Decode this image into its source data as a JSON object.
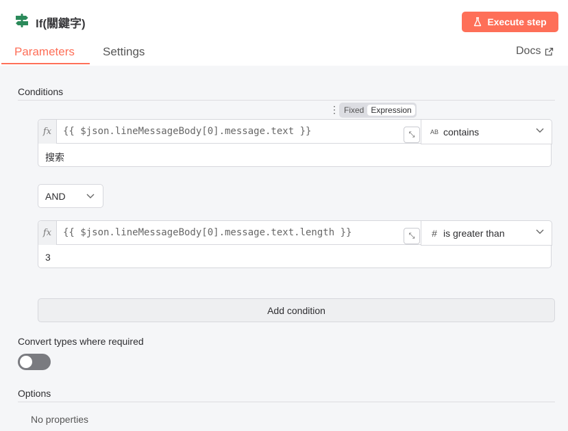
{
  "header": {
    "node_title": "If(關鍵字)",
    "execute_label": "Execute step",
    "tabs": [
      {
        "label": "Parameters",
        "active": true
      },
      {
        "label": "Settings",
        "active": false
      }
    ],
    "docs_label": "Docs"
  },
  "conditions": {
    "label": "Conditions",
    "mode_toggle": {
      "fixed": "Fixed",
      "expression": "Expression",
      "selected": "Expression"
    },
    "items": [
      {
        "fx": "fx",
        "left_value": "{{ $json.lineMessageBody[0].message.text }}",
        "operator_icon": "string-type-icon",
        "operator_icon_glyph": "AB",
        "operator": "contains",
        "right_value": "搜索"
      },
      {
        "fx": "fx",
        "left_value": "{{ $json.lineMessageBody[0].message.text.length }}",
        "operator_icon": "number-type-icon",
        "operator_icon_glyph": "#",
        "operator": "is greater than",
        "right_value": "3"
      }
    ],
    "combinator": "AND",
    "add_label": "Add condition"
  },
  "convert_types": {
    "label": "Convert types where required",
    "enabled": false
  },
  "options": {
    "label": "Options",
    "empty_text": "No properties"
  },
  "colors": {
    "accent": "#fe6f58",
    "node_icon": "#2b8a5a",
    "toggle_off": "#7a7b80"
  }
}
